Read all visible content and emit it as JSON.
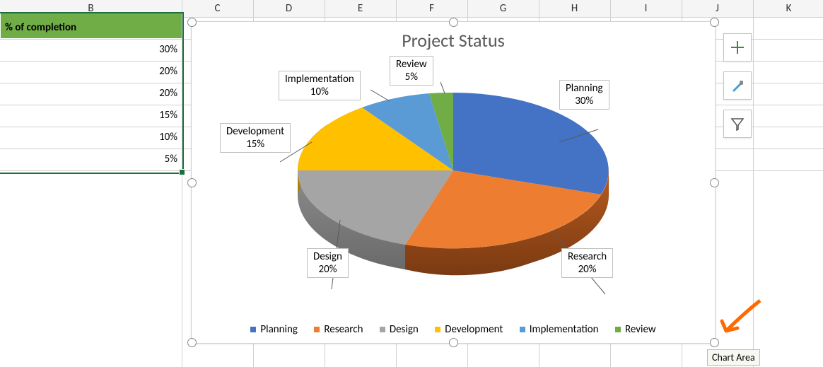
{
  "chart_data": {
    "type": "pie",
    "title": "Project Status",
    "categories": [
      "Planning",
      "Research",
      "Design",
      "Development",
      "Implementation",
      "Review"
    ],
    "values": [
      30,
      20,
      20,
      15,
      10,
      5
    ],
    "series": [
      {
        "name": "% of completion",
        "values": [
          30,
          20,
          20,
          15,
          10,
          5
        ]
      }
    ],
    "colors": [
      "#4472c4",
      "#ed7d31",
      "#a5a5a5",
      "#ffc000",
      "#5b9bd5",
      "#70ad47"
    ],
    "data_labels": [
      "Planning 30%",
      "Research 20%",
      "Design 20%",
      "Development 15%",
      "Implementation 10%",
      "Review 5%"
    ],
    "legend_position": "bottom",
    "style": "3d"
  },
  "columns": {
    "B": "B",
    "C": "C",
    "D": "D",
    "E": "E",
    "F": "F",
    "G": "G",
    "H": "H",
    "I": "I",
    "J": "J",
    "K": "K"
  },
  "header": {
    "b": "% of completion"
  },
  "data_cells": {
    "b2": "30%",
    "b3": "20%",
    "b4": "20%",
    "b5": "15%",
    "b6": "10%",
    "b7": "5%"
  },
  "labels": {
    "planning_a": "Planning",
    "planning_b": "30%",
    "research_a": "Research",
    "research_b": "20%",
    "design_a": "Design",
    "design_b": "20%",
    "dev_a": "Development",
    "dev_b": "15%",
    "impl_a": "Implementation",
    "impl_b": "10%",
    "rev_a": "Review",
    "rev_b": "5%"
  },
  "legend": {
    "planning": "Planning",
    "research": "Research",
    "design": "Design",
    "dev": "Development",
    "impl": "Implementation",
    "rev": "Review"
  },
  "tooltip": {
    "chart_area": "Chart Area"
  }
}
